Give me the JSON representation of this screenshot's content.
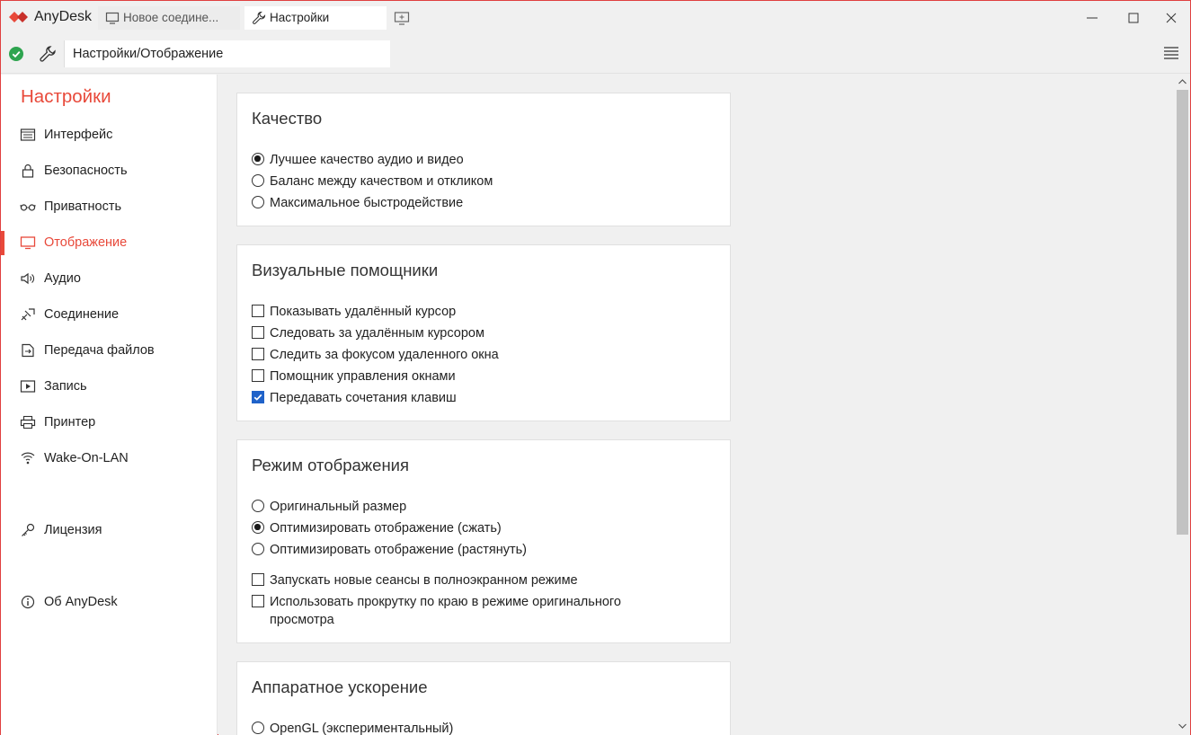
{
  "app": {
    "name": "AnyDesk",
    "accent": "#e8493a",
    "tabs": [
      {
        "label": "Новое соедине...",
        "icon": "monitor-icon"
      },
      {
        "label": "Настройки",
        "icon": "wrench-icon"
      }
    ]
  },
  "address": {
    "path": "Настройки/Отображение",
    "status": "connected-ok"
  },
  "sidebar": {
    "title": "Настройки",
    "items": [
      {
        "label": "Интерфейс",
        "icon": "interface-icon"
      },
      {
        "label": "Безопасность",
        "icon": "lock-icon"
      },
      {
        "label": "Приватность",
        "icon": "glasses-icon"
      },
      {
        "label": "Отображение",
        "icon": "display-icon",
        "active": true
      },
      {
        "label": "Аудио",
        "icon": "speaker-icon"
      },
      {
        "label": "Соединение",
        "icon": "connection-icon"
      },
      {
        "label": "Передача файлов",
        "icon": "file-transfer-icon"
      },
      {
        "label": "Запись",
        "icon": "recording-icon"
      },
      {
        "label": "Принтер",
        "icon": "printer-icon"
      },
      {
        "label": "Wake-On-LAN",
        "icon": "wifi-icon"
      },
      {
        "label": "Лицензия",
        "icon": "key-icon"
      },
      {
        "label": "Об AnyDesk",
        "icon": "info-icon"
      }
    ]
  },
  "sections": {
    "quality": {
      "title": "Качество",
      "options": [
        {
          "label": "Лучшее качество аудио и видео",
          "checked": true
        },
        {
          "label": "Баланс между качеством и откликом",
          "checked": false
        },
        {
          "label": "Максимальное быстродействие",
          "checked": false
        }
      ]
    },
    "visual": {
      "title": "Визуальные помощники",
      "options": [
        {
          "label": "Показывать удалённый курсор",
          "checked": false
        },
        {
          "label": "Следовать за удалённым курсором",
          "checked": false
        },
        {
          "label": "Следить за фокусом удаленного окна",
          "checked": false
        },
        {
          "label": "Помощник управления окнами",
          "checked": false
        },
        {
          "label": "Передавать сочетания клавиш",
          "checked": true
        }
      ]
    },
    "display_mode": {
      "title": "Режим отображения",
      "radios": [
        {
          "label": "Оригинальный размер",
          "checked": false
        },
        {
          "label": "Оптимизировать отображение (сжать)",
          "checked": true
        },
        {
          "label": "Оптимизировать отображение (растянуть)",
          "checked": false
        }
      ],
      "checks": [
        {
          "label": "Запускать новые сеансы в полноэкранном режиме",
          "checked": false
        },
        {
          "label": "Использовать прокрутку по краю в режиме оригинального",
          "label_line2": "просмотра",
          "checked": false
        }
      ]
    },
    "hw_accel": {
      "title": "Аппаратное ускорение",
      "options": [
        {
          "label": "OpenGL (экспериментальный)",
          "checked": false
        }
      ]
    }
  }
}
